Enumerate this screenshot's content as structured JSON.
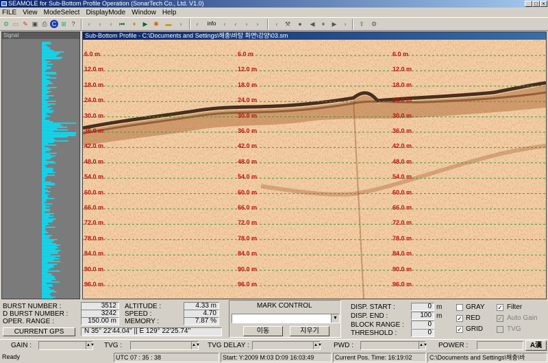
{
  "window": {
    "title": "SEAMOLE for Sub-Bottom Profile Operation (SonarTech Co., Ltd.  V1.0)"
  },
  "menu": [
    "FILE",
    "View",
    "ModeSelect",
    "DisplayMode",
    "Window",
    "Help"
  ],
  "signal_panel": {
    "title": "Signal"
  },
  "profile": {
    "title": "Sub-Bottom Profile - C:\\Documents and Settings\\해충\\바탕 화면\\강양\\03.sm",
    "depth_labels": [
      "6.0 m",
      "12.0 m",
      "18.0 m",
      "24.0 m",
      "30.0 m",
      "36.0 m",
      "42.0 m",
      "48.0 m",
      "54.0 m",
      "60.0 m",
      "66.0 m",
      "72.0 m",
      "78.0 m",
      "84.0 m",
      "90.0 m",
      "96.0 m"
    ]
  },
  "info": {
    "burst_number_label": "BURST NUMBER :",
    "burst_number": "3512",
    "d_burst_number_label": "D BURST NUMBER :",
    "d_burst_number": "3242",
    "oper_range_label": "OPER. RANGE :",
    "oper_range": "150.00 m",
    "altitude_label": "ALTITUDE :",
    "altitude": "4.33 m",
    "speed_label": "SPEED :",
    "speed": "4.70",
    "memory_label": "MEMORY :",
    "memory": "7.87 %",
    "current_gps_button": "CURRENT GPS",
    "gps": "N 35°  22'44.04'' || E 129°  22'25.74''"
  },
  "mark_control": {
    "title": "MARK CONTROL",
    "move_button": "이동",
    "clear_button": "지우기"
  },
  "display": {
    "disp_start_label": "DISP. START :",
    "disp_start": "0",
    "disp_start_unit": "m",
    "disp_end_label": "DISP. END :",
    "disp_end": "100",
    "disp_end_unit": "m",
    "block_range_label": "BLOCK RANGE :",
    "block_range": "0",
    "threshold_label": "THRESHOLD :",
    "threshold": "0"
  },
  "options": {
    "gray": "GRAY",
    "red": "RED",
    "grid": "GRID",
    "filter": "Filter",
    "auto_gain": "Auto Gain",
    "tvg": "TVG"
  },
  "controls": {
    "gain": "GAIN :",
    "tvg": "TVG :",
    "tvg_delay": "TVG DELAY :",
    "pwd": "PWD :",
    "power": "POWER :"
  },
  "ime_label": "A漢",
  "status": {
    "ready": "Ready",
    "utc": "UTC    07 : 35 : 38",
    "start": "Start: Y:2009 M:03 D:09 16:03:49",
    "current": "Current Pos. Time: 16:19:02",
    "path": "C:\\Documents and Settings\\해충\\바"
  },
  "colors": {
    "title_bar": "#0a246a",
    "profile_bg": "#f3c9a2",
    "signal_trace": "#00e5ff",
    "depth_label": "#c01010",
    "grid_line": "#3a9a3a"
  }
}
